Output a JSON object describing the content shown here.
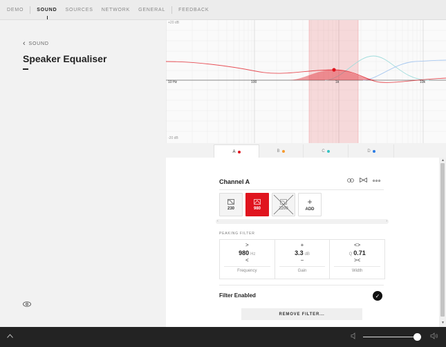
{
  "nav": {
    "items": [
      "DEMO",
      "SOUND",
      "SOURCES",
      "NETWORK",
      "GENERAL",
      "FEEDBACK"
    ],
    "active": "SOUND"
  },
  "left": {
    "back_label": "SOUND",
    "title": "Speaker Equaliser"
  },
  "graph": {
    "top_db": "+20 dB",
    "bottom_db": "-20 dB",
    "freq_labels": [
      "10 Hz",
      "100",
      "1k",
      "10k"
    ]
  },
  "tabs": [
    {
      "label": "A",
      "color": "#e0141e"
    },
    {
      "label": "B",
      "color": "#f59a2e"
    },
    {
      "label": "C",
      "color": "#33c2c2"
    },
    {
      "label": "D",
      "color": "#2a7be4"
    }
  ],
  "channel": {
    "title": "Channel A",
    "filters": [
      {
        "label": "230",
        "active": false
      },
      {
        "label": "980",
        "active": true
      },
      {
        "label": "2200",
        "active": false
      },
      {
        "label": "ADD",
        "active": false
      }
    ],
    "section_label": "PEAKING FILTER",
    "params": [
      {
        "top": ">",
        "pre": "",
        "value": "980",
        "unit": "Hz",
        "bottom": "<",
        "name": "Frequency"
      },
      {
        "top": "+",
        "pre": "",
        "value": "3.3",
        "unit": "dB",
        "bottom": "−",
        "name": "Gain"
      },
      {
        "top": "<>",
        "pre": "Q",
        "value": "0.71",
        "unit": "",
        "bottom": "><",
        "name": "Width"
      }
    ],
    "filter_enabled_label": "Filter Enabled",
    "remove_label": "REMOVE FILTER..."
  },
  "colors": {
    "accent": "#e0141e",
    "bottom_bar": "#232323"
  }
}
